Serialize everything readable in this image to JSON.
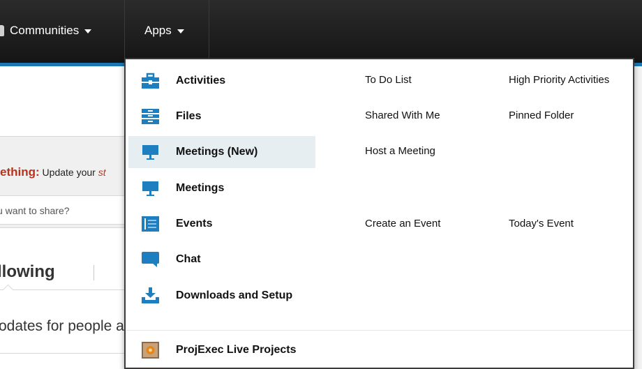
{
  "nav": {
    "communities_label": "Communities",
    "apps_label": "Apps"
  },
  "background": {
    "status_strong": "ething:",
    "status_prompt": " Update your ",
    "status_link": "st",
    "share_placeholder": "u want to share?",
    "following_tab": "llowing",
    "updates_text": "odates for people a"
  },
  "menu": {
    "items": [
      {
        "label": "Activities",
        "icon": "activities-icon"
      },
      {
        "label": "Files",
        "icon": "files-icon"
      },
      {
        "label": "Meetings (New)",
        "icon": "meetings-new-icon"
      },
      {
        "label": "Meetings",
        "icon": "meetings-icon"
      },
      {
        "label": "Events",
        "icon": "events-icon"
      },
      {
        "label": "Chat",
        "icon": "chat-icon"
      },
      {
        "label": "Downloads and Setup",
        "icon": "downloads-icon"
      },
      {
        "label": "ProjExec Live Projects",
        "icon": "projexec-icon"
      }
    ],
    "links": {
      "todo_list": "To Do List",
      "high_priority": "High Priority Activities",
      "shared_with_me": "Shared With Me",
      "pinned_folder": "Pinned Folder",
      "host_meeting": "Host a Meeting",
      "create_event": "Create an Event",
      "todays_event": "Today's Event"
    }
  },
  "colors": {
    "accent": "#1a78b8",
    "icon_blue": "#1d7fc0",
    "status_red": "#b8321c",
    "hover_bg": "#e6eef2"
  }
}
